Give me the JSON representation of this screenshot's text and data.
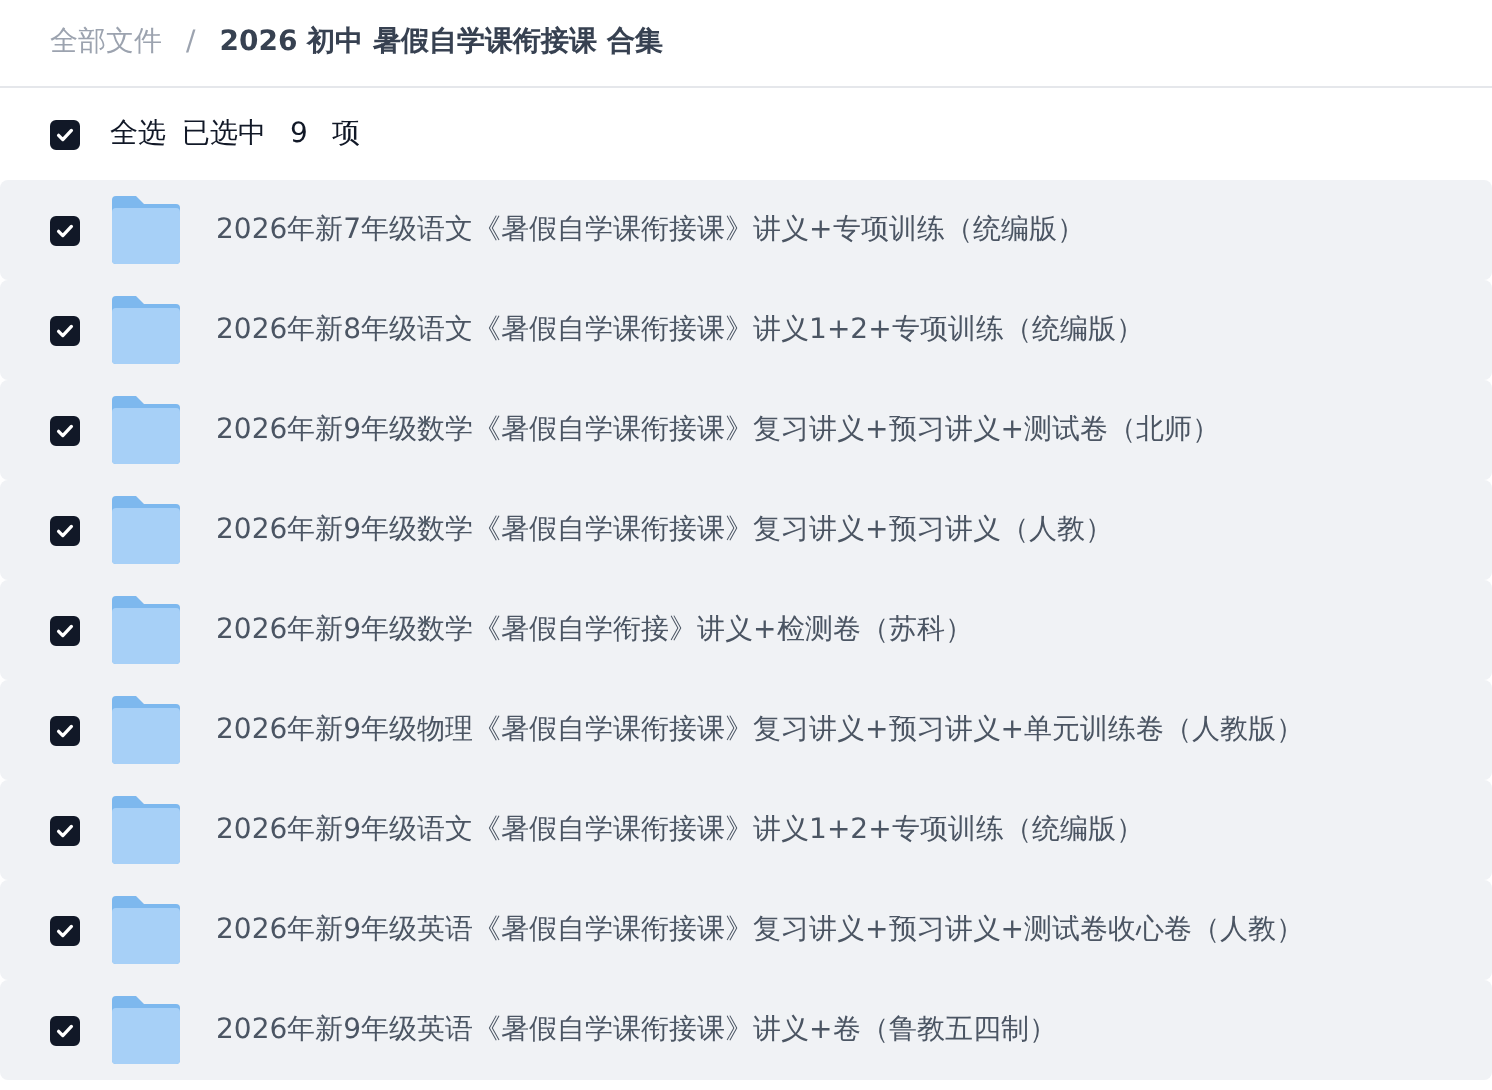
{
  "breadcrumb": {
    "root": "全部文件",
    "separator": "/",
    "current": "2026 初中 暑假自学课衔接课 合集"
  },
  "select_all": {
    "checked": true,
    "label": "全选",
    "summary": "已选中",
    "count": "9",
    "unit": "项"
  },
  "files": [
    {
      "name": "2026年新7年级语文《暑假自学课衔接课》讲义+专项训练（统编版）",
      "selected": true
    },
    {
      "name": "2026年新8年级语文《暑假自学课衔接课》讲义1+2+专项训练（统编版）",
      "selected": true
    },
    {
      "name": "2026年新9年级数学《暑假自学课衔接课》复习讲义+预习讲义+测试卷（北师）",
      "selected": true
    },
    {
      "name": "2026年新9年级数学《暑假自学课衔接课》复习讲义+预习讲义（人教）",
      "selected": true
    },
    {
      "name": "2026年新9年级数学《暑假自学衔接》讲义+检测卷（苏科）",
      "selected": true
    },
    {
      "name": "2026年新9年级物理《暑假自学课衔接课》复习讲义+预习讲义+单元训练卷（人教版）",
      "selected": true
    },
    {
      "name": "2026年新9年级语文《暑假自学课衔接课》讲义1+2+专项训练（统编版）",
      "selected": true
    },
    {
      "name": "2026年新9年级英语《暑假自学课衔接课》复习讲义+预习讲义+测试卷收心卷（人教）",
      "selected": true
    },
    {
      "name": "2026年新9年级英语《暑假自学课衔接课》讲义+卷（鲁教五四制）",
      "selected": true
    }
  ]
}
